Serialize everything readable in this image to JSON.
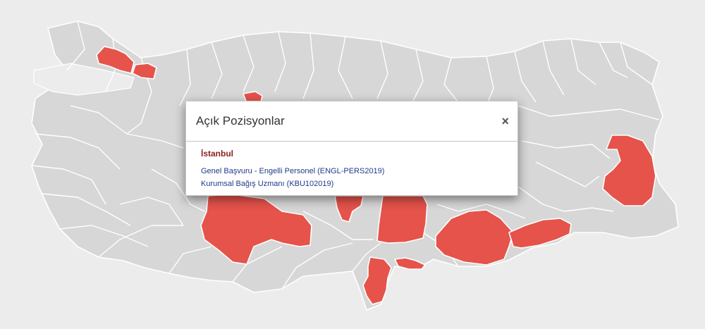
{
  "map": {
    "highlight_color": "#e5534b",
    "province_color": "#d7d7d7",
    "background_color": "#ececec"
  },
  "modal": {
    "title": "Açık Pozisyonlar",
    "close_icon": "close-icon",
    "close_glyph": "×",
    "city": "İstanbul",
    "positions": [
      "Genel Başvuru - Engelli Personel (ENGL-PERS2019)",
      "Kurumsal Bağış Uzmanı (KBU102019)"
    ]
  }
}
